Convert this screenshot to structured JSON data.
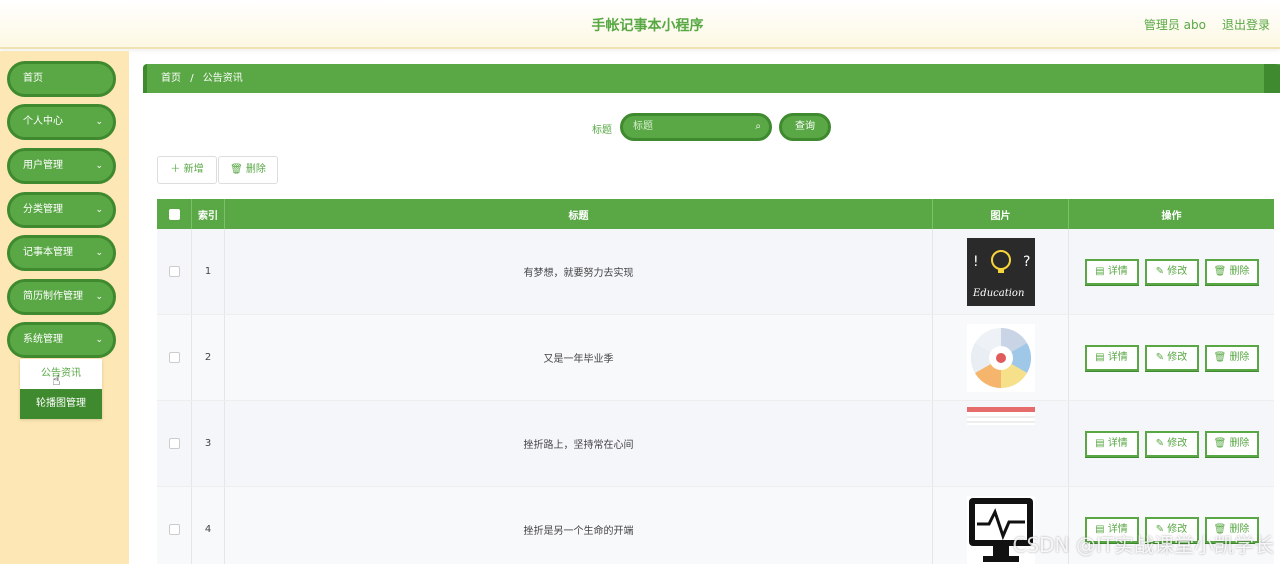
{
  "header": {
    "title": "手帐记事本小程序",
    "user": "管理员 abo",
    "logout": "退出登录"
  },
  "sidebar": {
    "items": [
      {
        "label": "首页",
        "chevron": false
      },
      {
        "label": "个人中心",
        "chevron": true
      },
      {
        "label": "用户管理",
        "chevron": true
      },
      {
        "label": "分类管理",
        "chevron": true
      },
      {
        "label": "记事本管理",
        "chevron": true
      },
      {
        "label": "简历制作管理",
        "chevron": true
      },
      {
        "label": "系统管理",
        "chevron": true
      }
    ],
    "submenu": [
      {
        "label": "公告资讯"
      },
      {
        "label": "轮播图管理"
      }
    ]
  },
  "breadcrumb": {
    "home": "首页",
    "sep": "/",
    "current": "公告资讯"
  },
  "search": {
    "label": "标题",
    "placeholder": "标题",
    "button": "查询"
  },
  "toolbar": {
    "add": "＋ 新增",
    "delete": "🗑 删除"
  },
  "table": {
    "headers": {
      "index": "索引",
      "title": "标题",
      "picture": "图片",
      "ops": "操作"
    },
    "rows": [
      {
        "index": "1",
        "title": "有梦想，就要努力去实现"
      },
      {
        "index": "2",
        "title": "又是一年毕业季"
      },
      {
        "index": "3",
        "title": "挫折路上，坚持常在心间"
      },
      {
        "index": "4",
        "title": "挫折是另一个生命的开端"
      }
    ],
    "op_labels": {
      "detail": "详情",
      "edit": "修改",
      "delete": "删除"
    }
  },
  "watermark": "CSDN @IT实战课堂小凯学长",
  "colors": {
    "accent": "#5aa845",
    "accent_dark": "#3f8a2f",
    "sidebar_bg": "#fde7b4"
  }
}
